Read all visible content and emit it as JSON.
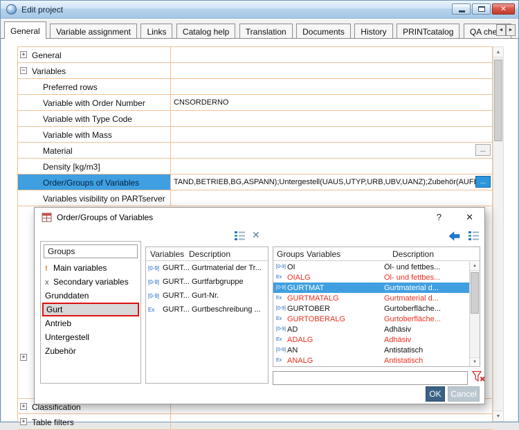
{
  "colors": {
    "accent": "#3f9fe0",
    "gridline": "#f0bf96",
    "red": "#e8301f",
    "iconblue": "#1565c0",
    "ok": "#3a6286",
    "cancel": "#bac7cf",
    "selred": "#dd1111"
  },
  "window": {
    "title": "Edit project"
  },
  "icons": {
    "close": "✕",
    "help": "?",
    "scroll_left": "◄",
    "scroll_right": "►",
    "scroll_up": "▲",
    "scroll_down": "▼",
    "remove": "✕",
    "main_variables": "!",
    "secondary_variables": "x"
  },
  "tabs": {
    "items": [
      "General",
      "Variable assignment",
      "Links",
      "Catalog help",
      "Translation",
      "Documents",
      "History",
      "PRINTcatalog",
      "QA check"
    ]
  },
  "grid": {
    "rows": [
      {
        "label": "General",
        "value": "",
        "expander": "+"
      },
      {
        "label": "Variables",
        "value": "",
        "expander": "−"
      },
      {
        "label": "Preferred rows",
        "value": ""
      },
      {
        "label": "Variable with Order Number",
        "value": "CNSORDERNO"
      },
      {
        "label": "Variable with Type Code",
        "value": ""
      },
      {
        "label": "Variable with Mass",
        "value": ""
      },
      {
        "label": "Material",
        "value": "",
        "button": "..."
      },
      {
        "label": "Density [kg/m3]",
        "value": ""
      },
      {
        "label": "Order/Groups of Variables",
        "value": "TAND,BETRIEB,BG,ASPANN);Untergestell(UAUS,UTYP,URB,UBV,UANZ);Zubehör(AUFB)",
        "button": "..."
      },
      {
        "label": "Variables visibility on PARTserver",
        "value": ""
      }
    ],
    "partial_row_expander": "+",
    "bottom_rows": [
      {
        "label": "Classification",
        "expander": "+"
      },
      {
        "label": "Table filters",
        "expander": "+"
      }
    ]
  },
  "dialog": {
    "title": "Order/Groups of Variables",
    "groups": {
      "header": "Groups",
      "items": [
        {
          "label": "Main variables"
        },
        {
          "label": "Secondary variables"
        },
        {
          "label": "Grunddaten"
        },
        {
          "label": "Gurt"
        },
        {
          "label": "Antrieb"
        },
        {
          "label": "Untergestell"
        },
        {
          "label": "Zubehör"
        }
      ]
    },
    "variables": {
      "headers": {
        "variables": "Variables",
        "description": "Description"
      },
      "rows": [
        {
          "icon": "[0-9]",
          "name": "GURT...",
          "desc": "Gurtmaterial der Tr..."
        },
        {
          "icon": "[0-9]",
          "name": "GURT...",
          "desc": "Gurtfarbgruppe"
        },
        {
          "icon": "[0-9]",
          "name": "GURT...",
          "desc": "Gurt-Nr."
        },
        {
          "icon": "Ex",
          "name": "GURT...",
          "desc": "Gurtbeschreibung ..."
        }
      ]
    },
    "selection": {
      "headers": {
        "groups": "Groups",
        "variables": "Variables",
        "description": "Description"
      },
      "rows": [
        {
          "icon": "[0-9]",
          "name": "OI",
          "desc": "Öl- und fettbes..."
        },
        {
          "icon": "Ex",
          "name": "OIALG",
          "desc": "Öl- und fettbes..."
        },
        {
          "icon": "[0-9]",
          "name": "GURTMAT",
          "desc": "Gurtmaterial d..."
        },
        {
          "icon": "Ex",
          "name": "GURTMATALG",
          "desc": "Gurtmaterial d..."
        },
        {
          "icon": "[0-9]",
          "name": "GURTOBER",
          "desc": "Gurtoberfläche..."
        },
        {
          "icon": "Ex",
          "name": "GURTOBERALG",
          "desc": "Gurtoberfläche..."
        },
        {
          "icon": "[0-9]",
          "name": "AD",
          "desc": "Adhäsiv"
        },
        {
          "icon": "Ex",
          "name": "ADALG",
          "desc": "Adhäsiv"
        },
        {
          "icon": "[0-9]",
          "name": "AN",
          "desc": "Antistatisch"
        },
        {
          "icon": "Ex",
          "name": "ANALG",
          "desc": "Antistatisch"
        }
      ]
    },
    "filter_input": {
      "value": ""
    },
    "buttons": {
      "ok": "OK",
      "cancel": "Cancel"
    }
  }
}
